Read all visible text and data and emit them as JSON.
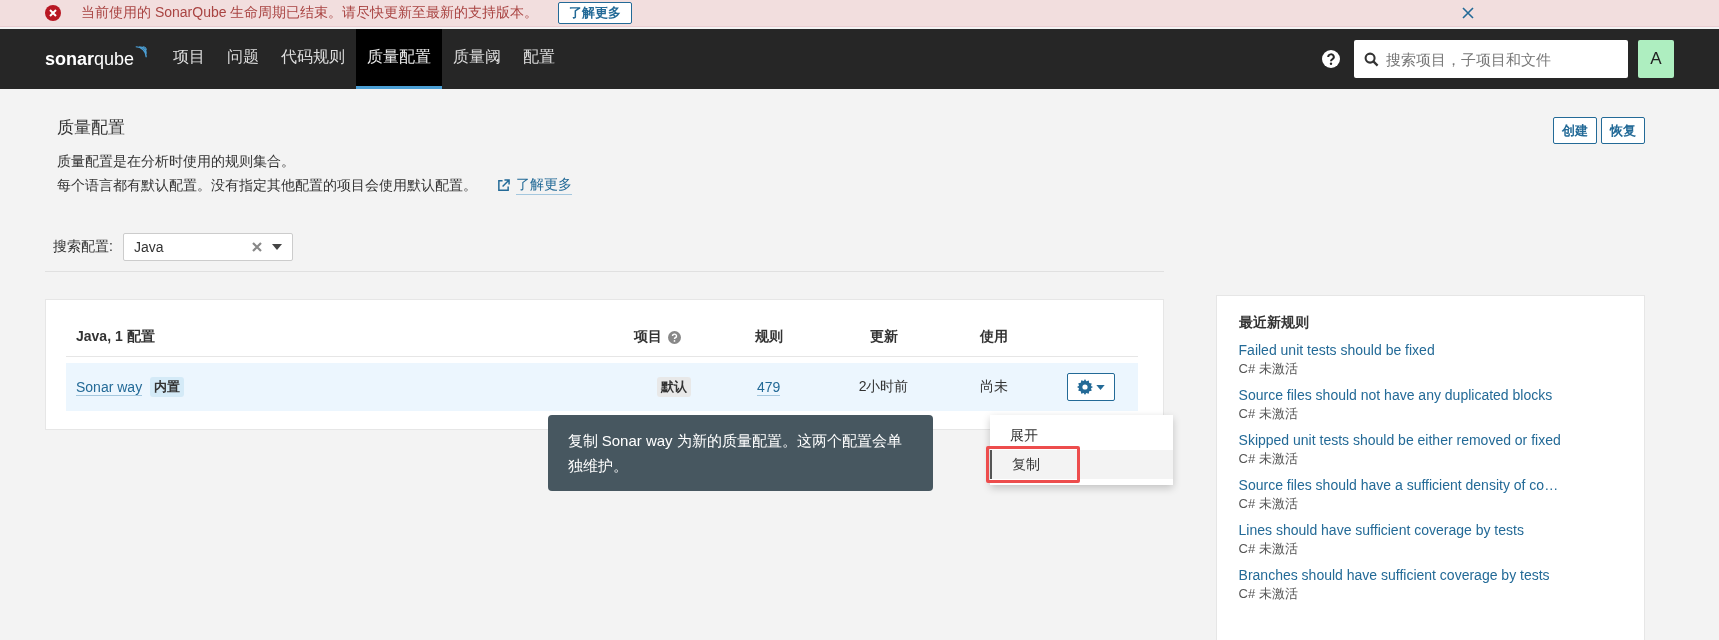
{
  "banner": {
    "message": "当前使用的 SonarQube 生命周期已结束。请尽快更新至最新的支持版本。",
    "button": "了解更多"
  },
  "nav": {
    "logo_bold": "sonar",
    "logo_light": "qube",
    "items": [
      {
        "label": "项目",
        "selected": false
      },
      {
        "label": "问题",
        "selected": false
      },
      {
        "label": "代码规则",
        "selected": false
      },
      {
        "label": "质量配置",
        "selected": true
      },
      {
        "label": "质量阈",
        "selected": false
      },
      {
        "label": "配置",
        "selected": false
      }
    ],
    "search": {
      "placeholder": "搜索项目，子项目和文件"
    },
    "avatar": "A"
  },
  "page": {
    "title": "质量配置",
    "description": [
      "质量配置是在分析时使用的规则集合。",
      "每个语言都有默认配置。没有指定其他配置的项目会使用默认配置。"
    ],
    "learn_more": "了解更多",
    "buttons": [
      "创建",
      "恢复"
    ]
  },
  "filter": {
    "label": "搜索配置:",
    "value": "Java"
  },
  "table": {
    "columns": [
      "Java, 1 配置",
      "项目",
      "规则",
      "更新",
      "使用"
    ],
    "rows": [
      {
        "name": "Sonar way",
        "badge": "内置",
        "projects": "默认",
        "rules": "479",
        "updated": "2小时前",
        "used": "尚未",
        "selected": true
      }
    ]
  },
  "menu": {
    "items": [
      {
        "label": "展开",
        "hovered": false,
        "annotated": false
      },
      {
        "label": "复制",
        "hovered": true,
        "annotated": true
      }
    ],
    "tooltip": "复制 Sonar way 为新的质量配置。这两个配置会单独维护。"
  },
  "recent_rules": {
    "title": "最近新规则",
    "items": [
      {
        "name": "Failed unit tests should be fixed",
        "meta": "C# 未激活"
      },
      {
        "name": "Source files should not have any duplicated blocks",
        "meta": "C# 未激活"
      },
      {
        "name": "Skipped unit tests should be either removed or fixed",
        "meta": "C# 未激活"
      },
      {
        "name": "Source files should have a sufficient density of co…",
        "meta": "C# 未激活"
      },
      {
        "name": "Lines should have sufficient coverage by tests",
        "meta": "C# 未激活"
      },
      {
        "name": "Branches should have sufficient coverage by tests",
        "meta": "C# 未激活"
      }
    ]
  }
}
